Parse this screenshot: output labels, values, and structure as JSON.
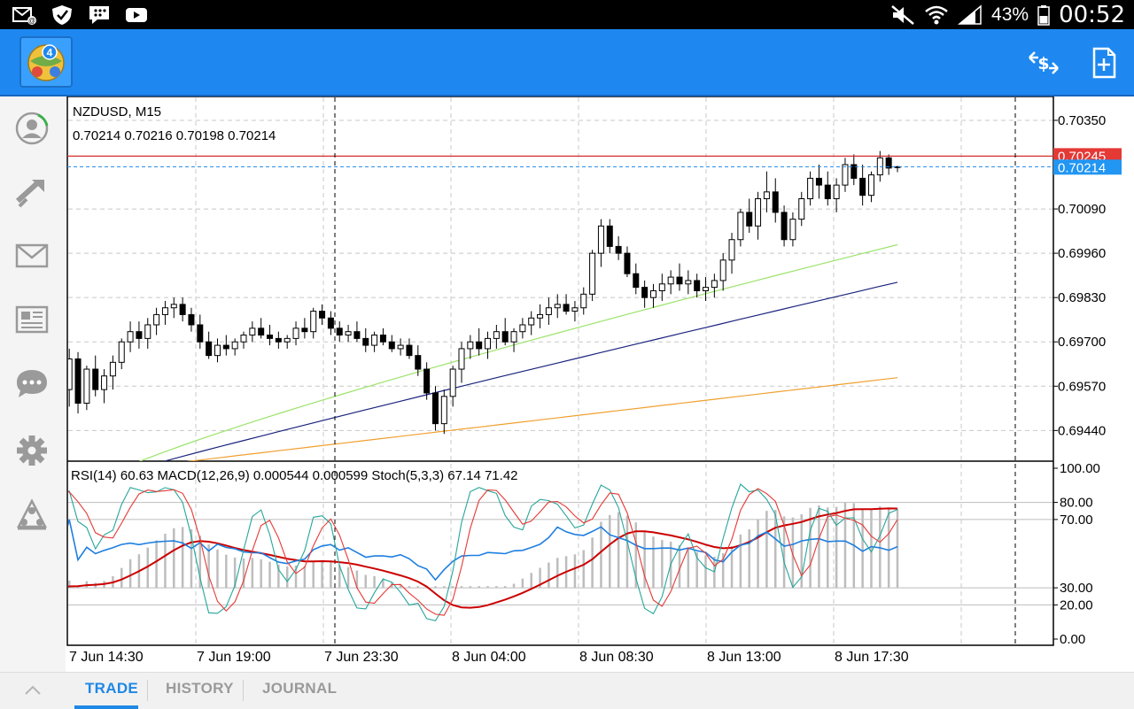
{
  "status_bar": {
    "icons_left": [
      "mail-notification-icon",
      "shield-icon",
      "blackberry-messenger-icon",
      "youtube-icon"
    ],
    "icons_right": [
      "mute-icon",
      "wifi-icon",
      "signal-icon",
      "battery-icon"
    ],
    "battery": "43%",
    "time": "00:52"
  },
  "app_bar": {
    "logo": "metatrader-4-logo",
    "actions": [
      "dollar-sync-icon",
      "new-order-icon"
    ]
  },
  "sidebar": {
    "items": [
      "account-icon",
      "trade-arrow-icon",
      "mail-icon",
      "news-icon",
      "chat-icon",
      "settings-icon",
      "community-icon"
    ]
  },
  "chart": {
    "symbol_label": "NZDUSD, M15",
    "ohlc_label": "0.70214 0.70216 0.70198 0.70214",
    "price_ticks": [
      "0.70350",
      "0.70090",
      "0.69960",
      "0.69830",
      "0.69700",
      "0.69570",
      "0.69440"
    ],
    "ask_label": "0.70245",
    "bid_label": "0.70214",
    "indicator_label": "RSI(14) 60.63 MACD(12,26,9) 0.000544 0.000599 Stoch(5,3,3) 67.14 71.42",
    "indicator_ticks": [
      "100.00",
      "80.00",
      "70.00",
      "30.00",
      "20.00",
      "0.00"
    ],
    "time_labels": [
      "7 Jun 14:30",
      "7 Jun 19:00",
      "7 Jun 23:30",
      "8 Jun 04:00",
      "8 Jun 08:30",
      "8 Jun 13:00",
      "8 Jun 17:30"
    ],
    "colors": {
      "ask_line": "#d32f2f",
      "bid_line": "#1e88e5",
      "ma_fast": "#9be36a",
      "ma_mid": "#1a237e",
      "ma_slow": "#f0a030",
      "rsi": "#1e7fe0",
      "stoch_main": "#26a69a",
      "stoch_signal": "#e53935",
      "macd_signal": "#cc0000",
      "macd_hist": "#bdbdbd"
    }
  },
  "chart_data": {
    "type": "candlestick",
    "symbol": "NZDUSD",
    "timeframe": "M15",
    "ylim": [
      0.6935,
      0.7042
    ],
    "last_ohlc": {
      "open": 0.70214,
      "high": 0.70216,
      "low": 0.70198,
      "close": 0.70214
    },
    "ask": 0.70245,
    "bid": 0.70214,
    "indicators": {
      "RSI": {
        "period": 14,
        "value": 60.63
      },
      "MACD": {
        "params": [
          12,
          26,
          9
        ],
        "main": 0.000544,
        "signal": 0.000599
      },
      "Stoch": {
        "params": [
          5,
          3,
          3
        ],
        "main": 67.14,
        "signal": 71.42
      }
    },
    "indicator_ylim": [
      0,
      100
    ],
    "indicator_levels": [
      80,
      70,
      30,
      20
    ],
    "candles": [
      [
        0.6948,
        0.6958,
        0.6944,
        0.6956
      ],
      [
        0.6956,
        0.6968,
        0.6951,
        0.6965
      ],
      [
        0.6965,
        0.6967,
        0.6949,
        0.6952
      ],
      [
        0.6952,
        0.6963,
        0.695,
        0.6962
      ],
      [
        0.6962,
        0.6966,
        0.6954,
        0.6956
      ],
      [
        0.6956,
        0.6962,
        0.6952,
        0.696
      ],
      [
        0.696,
        0.6966,
        0.6956,
        0.6964
      ],
      [
        0.6964,
        0.6971,
        0.6962,
        0.697
      ],
      [
        0.697,
        0.6976,
        0.6967,
        0.6973
      ],
      [
        0.6973,
        0.6976,
        0.6968,
        0.6971
      ],
      [
        0.6971,
        0.6977,
        0.6968,
        0.6975
      ],
      [
        0.6975,
        0.698,
        0.6972,
        0.6978
      ],
      [
        0.6978,
        0.6982,
        0.6975,
        0.698
      ],
      [
        0.698,
        0.6983,
        0.6977,
        0.6981
      ],
      [
        0.6981,
        0.6983,
        0.6976,
        0.6978
      ],
      [
        0.6978,
        0.698,
        0.6973,
        0.6975
      ],
      [
        0.6975,
        0.6978,
        0.6968,
        0.697
      ],
      [
        0.697,
        0.6973,
        0.6965,
        0.6966
      ],
      [
        0.6966,
        0.6971,
        0.6964,
        0.6969
      ],
      [
        0.6969,
        0.6972,
        0.6966,
        0.6968
      ],
      [
        0.6968,
        0.6971,
        0.6966,
        0.697
      ],
      [
        0.697,
        0.6973,
        0.6968,
        0.6972
      ],
      [
        0.6972,
        0.6976,
        0.697,
        0.6974
      ],
      [
        0.6974,
        0.6977,
        0.6971,
        0.6972
      ],
      [
        0.6972,
        0.6975,
        0.6969,
        0.6971
      ],
      [
        0.6971,
        0.6973,
        0.6968,
        0.697
      ],
      [
        0.697,
        0.6972,
        0.6968,
        0.6971
      ],
      [
        0.6971,
        0.6976,
        0.6969,
        0.6974
      ],
      [
        0.6974,
        0.6977,
        0.6971,
        0.6973
      ],
      [
        0.6973,
        0.698,
        0.6971,
        0.6979
      ],
      [
        0.6979,
        0.6981,
        0.6975,
        0.6977
      ],
      [
        0.6977,
        0.6979,
        0.6972,
        0.6974
      ],
      [
        0.6974,
        0.6976,
        0.697,
        0.6972
      ],
      [
        0.6972,
        0.6975,
        0.697,
        0.6973
      ],
      [
        0.6973,
        0.6976,
        0.697,
        0.6971
      ],
      [
        0.6971,
        0.6974,
        0.6967,
        0.6969
      ],
      [
        0.6969,
        0.6973,
        0.6967,
        0.6972
      ],
      [
        0.6972,
        0.6974,
        0.6969,
        0.697
      ],
      [
        0.697,
        0.6972,
        0.6967,
        0.6968
      ],
      [
        0.6968,
        0.6971,
        0.6966,
        0.6969
      ],
      [
        0.6969,
        0.6971,
        0.6965,
        0.6966
      ],
      [
        0.6966,
        0.6969,
        0.696,
        0.6962
      ],
      [
        0.6962,
        0.6964,
        0.6953,
        0.6955
      ],
      [
        0.6955,
        0.6957,
        0.6944,
        0.6946
      ],
      [
        0.6946,
        0.6956,
        0.6943,
        0.6954
      ],
      [
        0.6954,
        0.6963,
        0.6951,
        0.6962
      ],
      [
        0.6962,
        0.697,
        0.6958,
        0.6968
      ],
      [
        0.6968,
        0.6972,
        0.6965,
        0.697
      ],
      [
        0.697,
        0.6974,
        0.6966,
        0.6968
      ],
      [
        0.6968,
        0.6973,
        0.6965,
        0.6971
      ],
      [
        0.6971,
        0.6975,
        0.6968,
        0.6973
      ],
      [
        0.6973,
        0.6977,
        0.6969,
        0.697
      ],
      [
        0.697,
        0.6974,
        0.6967,
        0.6973
      ],
      [
        0.6973,
        0.6977,
        0.6971,
        0.6975
      ],
      [
        0.6975,
        0.6979,
        0.6972,
        0.6977
      ],
      [
        0.6977,
        0.6981,
        0.6974,
        0.6978
      ],
      [
        0.6978,
        0.6983,
        0.6975,
        0.698
      ],
      [
        0.698,
        0.6984,
        0.6977,
        0.6981
      ],
      [
        0.6981,
        0.6984,
        0.6978,
        0.6979
      ],
      [
        0.6979,
        0.6982,
        0.6976,
        0.698
      ],
      [
        0.698,
        0.6986,
        0.6978,
        0.6984
      ],
      [
        0.6984,
        0.6997,
        0.6982,
        0.6996
      ],
      [
        0.6996,
        0.7006,
        0.6992,
        0.7004
      ],
      [
        0.7004,
        0.7006,
        0.6996,
        0.6998
      ],
      [
        0.6998,
        0.7001,
        0.6994,
        0.6996
      ],
      [
        0.6996,
        0.6998,
        0.6989,
        0.699
      ],
      [
        0.699,
        0.6993,
        0.6984,
        0.6986
      ],
      [
        0.6986,
        0.6988,
        0.698,
        0.6983
      ],
      [
        0.6983,
        0.6987,
        0.698,
        0.6985
      ],
      [
        0.6985,
        0.699,
        0.6982,
        0.6987
      ],
      [
        0.6987,
        0.6991,
        0.6984,
        0.6989
      ],
      [
        0.6989,
        0.6993,
        0.6985,
        0.6987
      ],
      [
        0.6987,
        0.6991,
        0.6984,
        0.6988
      ],
      [
        0.6988,
        0.699,
        0.6983,
        0.6985
      ],
      [
        0.6985,
        0.6989,
        0.6982,
        0.6986
      ],
      [
        0.6986,
        0.699,
        0.6983,
        0.6988
      ],
      [
        0.6988,
        0.6996,
        0.6985,
        0.6994
      ],
      [
        0.6994,
        0.7002,
        0.699,
        0.7
      ],
      [
        0.7,
        0.7009,
        0.6998,
        0.7008
      ],
      [
        0.7008,
        0.7012,
        0.7002,
        0.7004
      ],
      [
        0.7004,
        0.7014,
        0.7,
        0.7012
      ],
      [
        0.7012,
        0.702,
        0.7008,
        0.7014
      ],
      [
        0.7014,
        0.7018,
        0.7005,
        0.7008
      ],
      [
        0.7008,
        0.701,
        0.6998,
        0.7
      ],
      [
        0.7,
        0.7008,
        0.6998,
        0.7006
      ],
      [
        0.7006,
        0.7014,
        0.7004,
        0.7012
      ],
      [
        0.7012,
        0.702,
        0.701,
        0.7018
      ],
      [
        0.7018,
        0.7022,
        0.7012,
        0.7016
      ],
      [
        0.7016,
        0.702,
        0.701,
        0.7012
      ],
      [
        0.7012,
        0.7018,
        0.7008,
        0.7016
      ],
      [
        0.7016,
        0.7024,
        0.7014,
        0.7022
      ],
      [
        0.7022,
        0.7025,
        0.7016,
        0.7018
      ],
      [
        0.7018,
        0.7022,
        0.701,
        0.7013
      ],
      [
        0.7013,
        0.702,
        0.7011,
        0.7019
      ],
      [
        0.7019,
        0.7026,
        0.7017,
        0.7024
      ],
      [
        0.7024,
        0.7025,
        0.7019,
        0.7021
      ],
      [
        0.70214,
        0.70216,
        0.70198,
        0.70214
      ]
    ],
    "ma_fast": {
      "start": 0.693,
      "end": 0.69985
    },
    "ma_mid": {
      "start": 0.693,
      "end": 0.69875
    },
    "ma_slow": {
      "start": 0.6932,
      "end": 0.69595
    },
    "x_labels": [
      "7 Jun 14:30",
      "7 Jun 19:00",
      "7 Jun 23:30",
      "8 Jun 04:00",
      "8 Jun 08:30",
      "8 Jun 13:00",
      "8 Jun 17:30"
    ]
  },
  "tabs": {
    "trade": "TRADE",
    "history": "HISTORY",
    "journal": "JOURNAL"
  }
}
